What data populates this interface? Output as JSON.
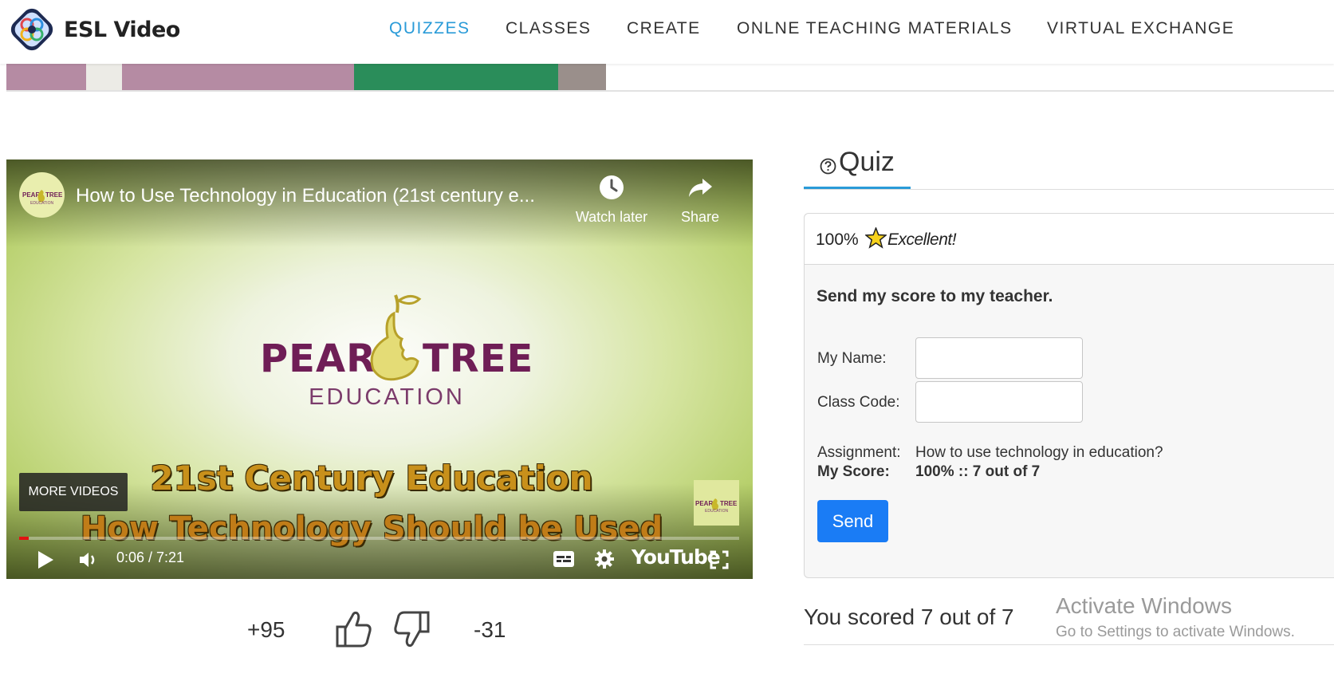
{
  "header": {
    "brand_name": "ESL Video",
    "nav": [
      {
        "label": "QUIZZES",
        "active": true
      },
      {
        "label": "CLASSES",
        "active": false
      },
      {
        "label": "CREATE",
        "active": false
      },
      {
        "label": "ONLNE TEACHING MATERIALS",
        "active": false
      },
      {
        "label": "VIRTUAL EXCHANGE",
        "active": false
      }
    ],
    "accent_color": "#2a9bd8"
  },
  "video": {
    "title": "How to Use Technology in Education (21st century e...",
    "watch_later_label": "Watch later",
    "share_label": "Share",
    "avatar_text_left": "PEAR",
    "avatar_text_right": "TREE",
    "avatar_sub": "EDUCATION",
    "logo_left": "PEAR",
    "logo_right": "TREE",
    "logo_sub": "EDUCATION",
    "caption_line1": "21st Century Education",
    "caption_line2": "How Technology Should be Used",
    "more_videos_label": "MORE VIDEOS",
    "time_display": "0:06 / 7:21",
    "progress_fraction": 0.0136,
    "youtube_label": "YouTube",
    "icons": [
      "clock-icon",
      "share-arrow-icon",
      "play-icon",
      "volume-icon",
      "subtitles-icon",
      "gear-icon",
      "fullscreen-icon"
    ],
    "progress_color": "#e21212"
  },
  "votes": {
    "up_count": "+95",
    "down_count": "-31",
    "icons": [
      "thumbs-up-icon",
      "thumbs-down-icon"
    ]
  },
  "quiz": {
    "tab_label": "Quiz",
    "tab_icon": "question-circle-icon",
    "score_percent": "100%",
    "score_word": "Excellent!",
    "score_icon": "star-icon",
    "send_title": "Send my score to my teacher.",
    "name_label": "My Name:",
    "name_value": "",
    "class_code_label": "Class Code:",
    "class_code_value": "",
    "assignment_label": "Assignment:",
    "assignment_value": "How to use technology in education?",
    "my_score_label": "My Score:",
    "my_score_value": "100% :: 7 out of 7",
    "send_label": "Send",
    "send_color": "#1a7cf5",
    "result_text": "You scored 7 out of 7"
  },
  "overlay": {
    "activate_title": "Activate Windows",
    "activate_sub": "Go to Settings to activate Windows."
  }
}
